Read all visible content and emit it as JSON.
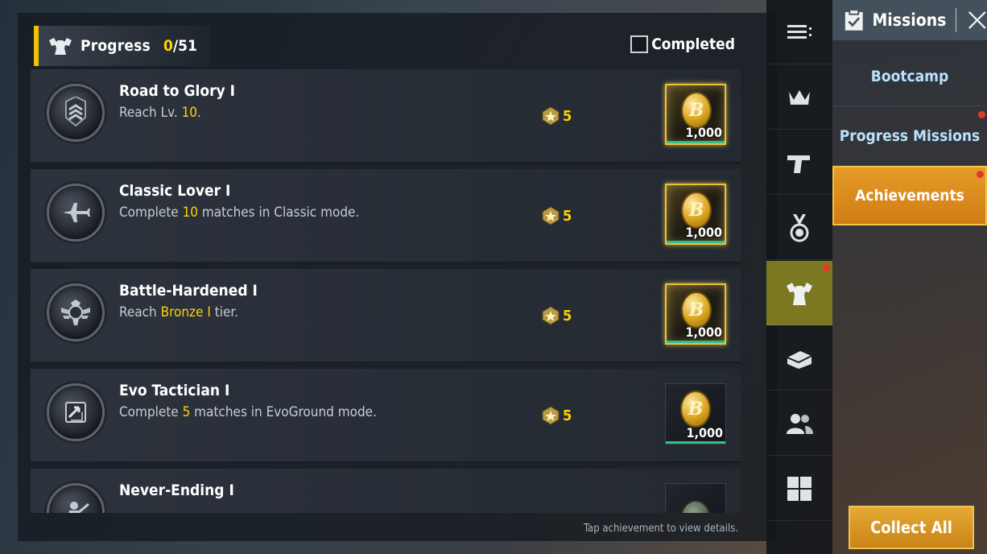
{
  "header": {
    "progress_label": "Progress",
    "progress_current": "0",
    "progress_total": "/51",
    "completed_label": "Completed"
  },
  "achievements": [
    {
      "title": "Road to Glory I",
      "desc_pre": "Reach Lv. ",
      "desc_hl": "10",
      "desc_post": ".",
      "points": "5",
      "reward_amount": "1,000",
      "ready": true,
      "icon": "chevron-rank-icon"
    },
    {
      "title": "Classic Lover I",
      "desc_pre": "Complete ",
      "desc_hl": "10",
      "desc_post": " matches in Classic mode.",
      "points": "5",
      "reward_amount": "1,000",
      "ready": true,
      "icon": "airplane-icon"
    },
    {
      "title": "Battle-Hardened I",
      "desc_pre": "Reach ",
      "desc_hl": "Bronze I",
      "desc_post": " tier.",
      "points": "5",
      "reward_amount": "1,000",
      "ready": true,
      "icon": "winged-emblem-icon"
    },
    {
      "title": "Evo Tactician I",
      "desc_pre": "Complete ",
      "desc_hl": "5",
      "desc_post": " matches in EvoGround mode.",
      "points": "5",
      "reward_amount": "1,000",
      "ready": false,
      "icon": "swap-arrows-icon"
    },
    {
      "title": "Never-Ending I",
      "desc_pre": "",
      "desc_hl": "",
      "desc_post": "",
      "points": "",
      "reward_amount": "",
      "ready": false,
      "icon": "soldier-icon"
    }
  ],
  "footer": {
    "hint": "Tap achievement to view details."
  },
  "categories": [
    {
      "icon": "menu-list-icon",
      "active": false,
      "dot": false
    },
    {
      "icon": "crown-icon",
      "active": false,
      "dot": false
    },
    {
      "icon": "pistol-icon",
      "active": false,
      "dot": false
    },
    {
      "icon": "medal-icon",
      "active": false,
      "dot": false
    },
    {
      "icon": "flexing-muscle-icon",
      "active": true,
      "dot": true
    },
    {
      "icon": "treasure-chest-icon",
      "active": false,
      "dot": false
    },
    {
      "icon": "friends-icon",
      "active": false,
      "dot": false
    },
    {
      "icon": "grid-icon",
      "active": false,
      "dot": false
    }
  ],
  "sidebar": {
    "title": "Missions",
    "items": [
      {
        "label": "Bootcamp",
        "active": false,
        "dot": false
      },
      {
        "label": "Progress Missions",
        "active": false,
        "dot": true
      },
      {
        "label": "Achievements",
        "active": true,
        "dot": true
      }
    ],
    "collect_all": "Collect All"
  },
  "colors": {
    "accent_yellow": "#ffd200",
    "active_orange": "#e59b26",
    "active_category": "#7c7822",
    "notification_red": "#e2382c"
  }
}
